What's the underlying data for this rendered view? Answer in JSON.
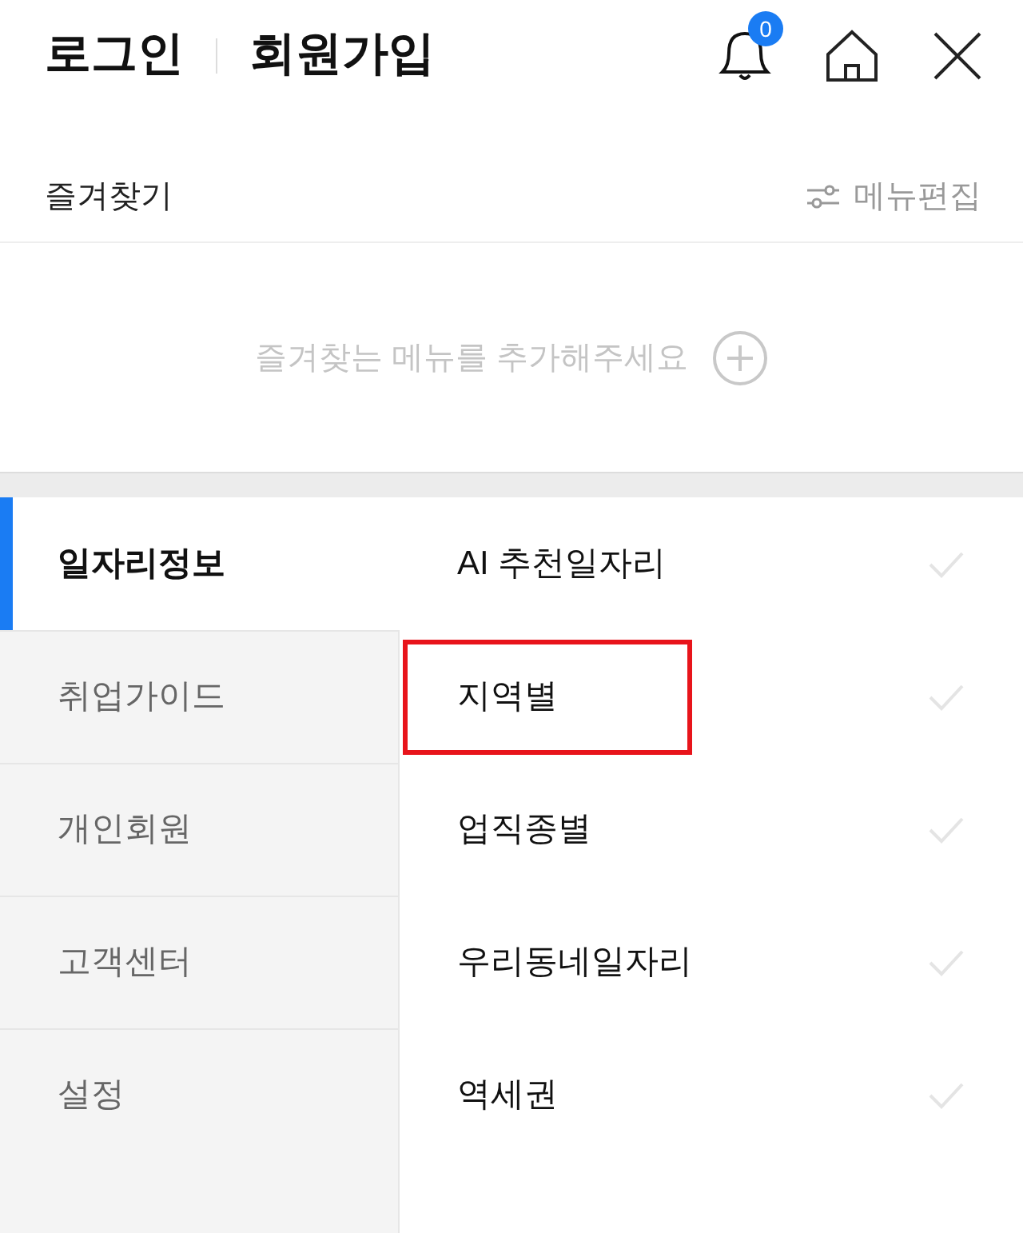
{
  "header": {
    "login": "로그인",
    "signup": "회원가입",
    "notification_count": "0"
  },
  "favorites": {
    "title": "즐겨찾기",
    "edit_label": "메뉴편집",
    "empty_message": "즐겨찾는 메뉴를 추가해주세요"
  },
  "categories": [
    {
      "label": "일자리정보",
      "selected": true
    },
    {
      "label": "취업가이드",
      "selected": false
    },
    {
      "label": "개인회원",
      "selected": false
    },
    {
      "label": "고객센터",
      "selected": false
    },
    {
      "label": "설정",
      "selected": false
    }
  ],
  "submenu": [
    {
      "label": "AI 추천일자리",
      "checked": false,
      "highlighted": false
    },
    {
      "label": "지역별",
      "checked": false,
      "highlighted": true
    },
    {
      "label": "업직종별",
      "checked": false,
      "highlighted": false
    },
    {
      "label": "우리동네일자리",
      "checked": false,
      "highlighted": false
    },
    {
      "label": "역세권",
      "checked": false,
      "highlighted": false
    }
  ]
}
